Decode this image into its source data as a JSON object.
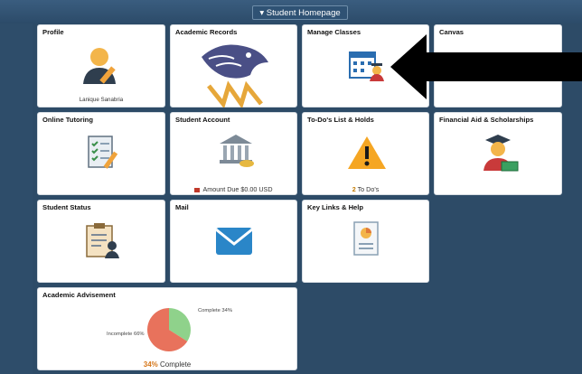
{
  "header": {
    "homepage_button": "▾ Student Homepage"
  },
  "tiles": {
    "profile": {
      "title": "Profile",
      "name": "Lanique Sanabria"
    },
    "academic_records": {
      "title": "Academic Records"
    },
    "manage_classes": {
      "title": "Manage Classes"
    },
    "canvas": {
      "title": "Canvas"
    },
    "online_tutoring": {
      "title": "Online Tutoring"
    },
    "student_account": {
      "title": "Student Account",
      "amount_due": "Amount Due $0.00 USD"
    },
    "todo": {
      "title": "To-Do's List & Holds",
      "count": "2",
      "label": "To Do's"
    },
    "financial_aid": {
      "title": "Financial Aid & Scholarships"
    },
    "student_status": {
      "title": "Student Status"
    },
    "mail": {
      "title": "Mail"
    },
    "key_links": {
      "title": "Key Links & Help"
    },
    "academic_advisement": {
      "title": "Academic Advisement",
      "complete_pct": "34%",
      "complete_word": "Complete",
      "legend_complete": "Complete 34%",
      "legend_incomplete": "Incomplete 66%"
    }
  },
  "chart_data": {
    "type": "pie",
    "categories": [
      "Complete",
      "Incomplete"
    ],
    "values": [
      34,
      66
    ],
    "colors": [
      "#8fd28b",
      "#e8725c"
    ]
  },
  "colors": {
    "page_bg": "#2e4d6a",
    "tile_bg": "#ffffff",
    "arrow": "#000000"
  }
}
